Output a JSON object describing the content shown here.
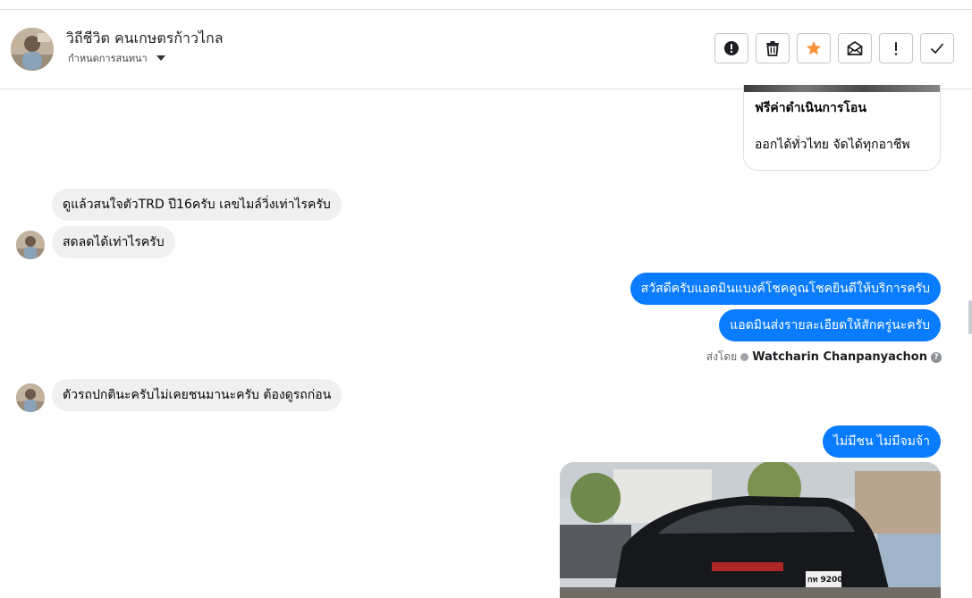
{
  "header": {
    "contact_name": "วิถีชีวิต คนเกษตรก้าวไกล",
    "assign_label": "กำหนดการสนทนา",
    "actions": [
      {
        "name": "report-spam-button",
        "icon": "alert-circle-icon"
      },
      {
        "name": "delete-button",
        "icon": "trash-icon"
      },
      {
        "name": "star-button",
        "icon": "star-icon"
      },
      {
        "name": "mark-unread-button",
        "icon": "mail-icon"
      },
      {
        "name": "follow-up-button",
        "icon": "exclamation-icon"
      },
      {
        "name": "mark-done-button",
        "icon": "check-icon"
      }
    ],
    "star_color": "#f7923a"
  },
  "card": {
    "title": "ฟรีค่าดำเนินการโอน",
    "subtitle": "ออกได้ทั่วไทย จัดได้ทุกอาชีพ"
  },
  "messages": {
    "in1": "ดูแล้วสนใจตัวTRD ปี16ครับ เลขไมล์วิ่งเท่าไรครับ",
    "in2": "สดลดได้เท่าไรครับ",
    "out1": "สวัสดีครับแอดมินแบงค์โชคคูณโชคยินดีให้บริการครับ",
    "out2": "แอดมินส่งรายละเอียดให้สักครู่นะครับ",
    "in3": "ตัวรถปกตินะครับไม่เคยชนมานะครับ ต้องดูรถก่อน",
    "out3": "ไม่มีชน ไม่มีจมจ้า"
  },
  "sent_by": {
    "prefix": "ส่งโดย",
    "name": "Watcharin Chanpanyachon",
    "help": "?"
  },
  "photo": {
    "plate": "กท 9200"
  },
  "colors": {
    "outgoing": "#0a7cff",
    "incoming": "#f0f0f0"
  }
}
